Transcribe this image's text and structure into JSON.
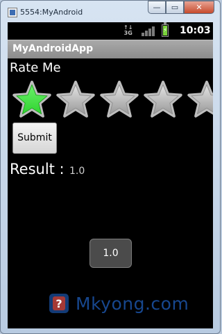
{
  "window": {
    "title": "5554:MyAndroid",
    "controls": [
      "—",
      "▭",
      "✕"
    ]
  },
  "status_bar": {
    "network": "3G",
    "time": "10:03"
  },
  "app_bar": {
    "title": "MyAndroidApp"
  },
  "rating": {
    "label": "Rate Me",
    "value": 1.0,
    "max": 5,
    "colors": {
      "filled": "#2fd42f",
      "empty": "#9a9a9a"
    }
  },
  "submit_button": {
    "label": "Submit"
  },
  "result": {
    "label": "Result :",
    "value": "1.0"
  },
  "toast": {
    "text": "1.0"
  },
  "watermark": {
    "text": "Mkyong.com",
    "icon": "question-mark-logo"
  }
}
